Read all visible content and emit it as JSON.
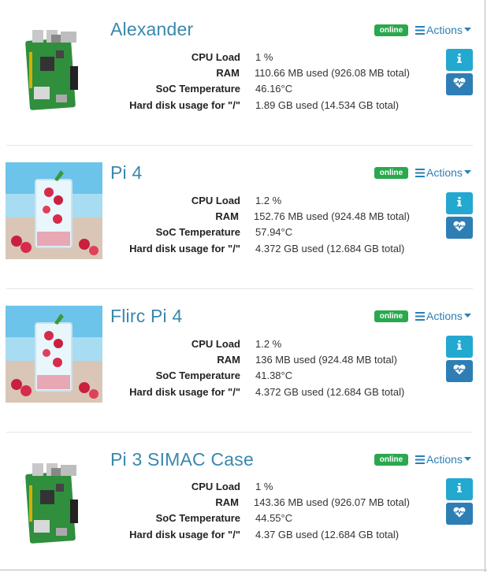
{
  "stat_labels": {
    "cpu": "CPU Load",
    "ram": "RAM",
    "temp": "SoC Temperature",
    "disk": "Hard disk usage for \"/\""
  },
  "actions_label": "Actions",
  "status_color": "#2aa84d",
  "devices": [
    {
      "name": "Alexander",
      "status": "online",
      "thumbnail": "raspberry-pi-board",
      "cpu": "1 %",
      "ram": "110.66 MB used (926.08 MB total)",
      "temp": "46.16°C",
      "disk": "1.89 GB used (14.534 GB total)"
    },
    {
      "name": "Pi 4",
      "status": "online",
      "thumbnail": "raspberry-drink-glass",
      "cpu": "1.2 %",
      "ram": "152.76 MB used (924.48 MB total)",
      "temp": "57.94°C",
      "disk": "4.372 GB used (12.684 GB total)"
    },
    {
      "name": "Flirc Pi 4",
      "status": "online",
      "thumbnail": "raspberry-drink-glass",
      "cpu": "1.2 %",
      "ram": "136 MB used (924.48 MB total)",
      "temp": "41.38°C",
      "disk": "4.372 GB used (12.684 GB total)"
    },
    {
      "name": "Pi 3 SIMAC Case",
      "status": "online",
      "thumbnail": "raspberry-pi-board",
      "cpu": "1 %",
      "ram": "143.36 MB used (926.07 MB total)",
      "temp": "44.55°C",
      "disk": "4.37 GB used (12.684 GB total)"
    }
  ]
}
